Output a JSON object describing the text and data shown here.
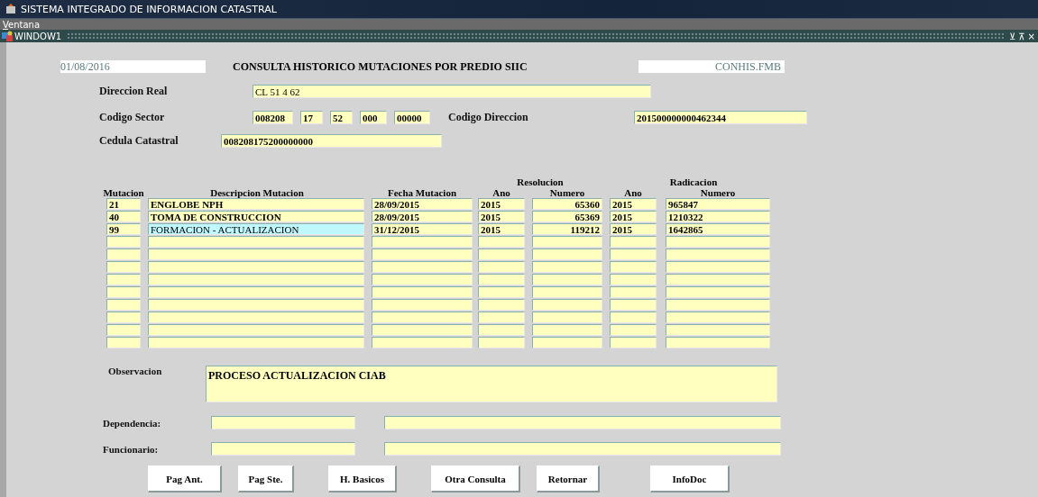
{
  "window": {
    "title": "SISTEMA INTEGRADO DE INFORMACION CATASTRAL"
  },
  "menu": [
    {
      "label": "Ventana"
    }
  ],
  "subwindow": {
    "title": "WINDOW1",
    "controls": [
      "⊻",
      "⊼",
      "×"
    ]
  },
  "form": {
    "date": "01/08/2016",
    "heading": "CONSULTA HISTORICO MUTACIONES POR PREDIO SIIC",
    "module": "CONHIS.FMB",
    "direccion_real": {
      "label": "Direccion Real",
      "value": "CL 51 4 62"
    },
    "codigo_sector": {
      "label": "Codigo Sector",
      "values": [
        "008208",
        "17",
        "52",
        "000",
        "00000"
      ]
    },
    "codigo_direccion": {
      "label": "Codigo Direccion",
      "value": "201500000000462344"
    },
    "cedula_catastral": {
      "label": "Cedula Catastral",
      "value": "008208175200000000"
    }
  },
  "table": {
    "groups": [
      "Resolucion",
      "Radicacion"
    ],
    "columns": [
      "Mutacion",
      "Descripcion Mutacion",
      "Fecha Mutacion",
      "Ano",
      "Numero",
      "Ano",
      "Numero"
    ],
    "rows": [
      {
        "cells": [
          "21",
          "ENGLOBE NPH",
          "28/09/2015",
          "2015",
          "65360",
          "2015",
          "965847"
        ],
        "selected": false
      },
      {
        "cells": [
          "40",
          "TOMA DE CONSTRUCCION",
          "28/09/2015",
          "2015",
          "65369",
          "2015",
          "1210322"
        ],
        "selected": false
      },
      {
        "cells": [
          "99",
          "FORMACION - ACTUALIZACION",
          "31/12/2015",
          "2015",
          "119212",
          "2015",
          "1642865"
        ],
        "selected": true
      }
    ]
  },
  "observacion": {
    "label": "Observacion",
    "value": "PROCESO ACTUALIZACION CIAB"
  },
  "dependencia": {
    "label": "Dependencia:"
  },
  "funcionario": {
    "label": "Funcionario:"
  },
  "buttons": [
    "Pag Ant.",
    "Pag Ste.",
    "H. Basicos",
    "Otra Consulta",
    "Retornar",
    "InfoDoc"
  ]
}
